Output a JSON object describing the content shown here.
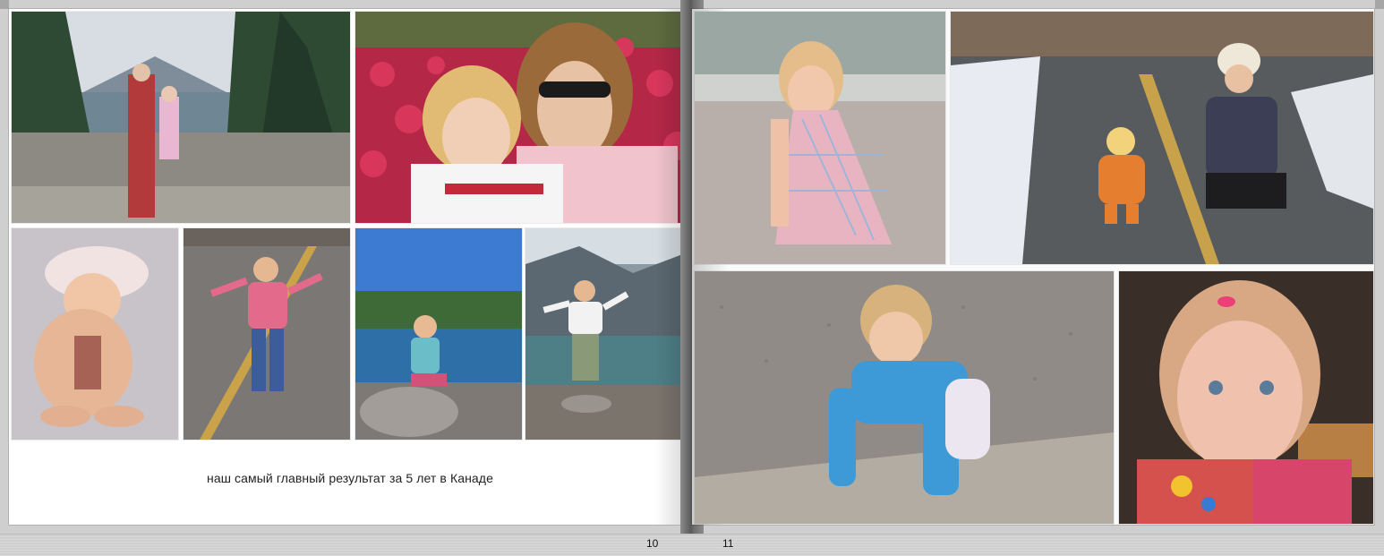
{
  "book": {
    "left_page": {
      "number": "10",
      "caption": "наш самый главный результат за 5 лет в Канаде",
      "photos": [
        {
          "name": "photo-family-lookout",
          "desc_icon": "image-icon"
        },
        {
          "name": "photo-mother-daughter-flowers",
          "desc_icon": "image-icon"
        },
        {
          "name": "photo-girl-sunhat-crouching",
          "desc_icon": "image-icon"
        },
        {
          "name": "photo-girl-running-road",
          "desc_icon": "image-icon"
        },
        {
          "name": "photo-girl-on-rock-lake",
          "desc_icon": "image-icon"
        },
        {
          "name": "photo-girl-mountains-beach",
          "desc_icon": "image-icon"
        }
      ]
    },
    "right_page": {
      "number": "11",
      "photos": [
        {
          "name": "photo-girl-sand-plaid-dress",
          "desc_icon": "image-icon"
        },
        {
          "name": "photo-mother-toddler-snow-path",
          "desc_icon": "image-icon"
        },
        {
          "name": "photo-toddler-crawling-gravel",
          "desc_icon": "image-icon"
        },
        {
          "name": "photo-girl-portrait-red-bib",
          "desc_icon": "image-icon"
        }
      ]
    }
  },
  "colors": {
    "frame": "#9c9c9c",
    "page": "#ffffff",
    "caption": "#222222"
  }
}
